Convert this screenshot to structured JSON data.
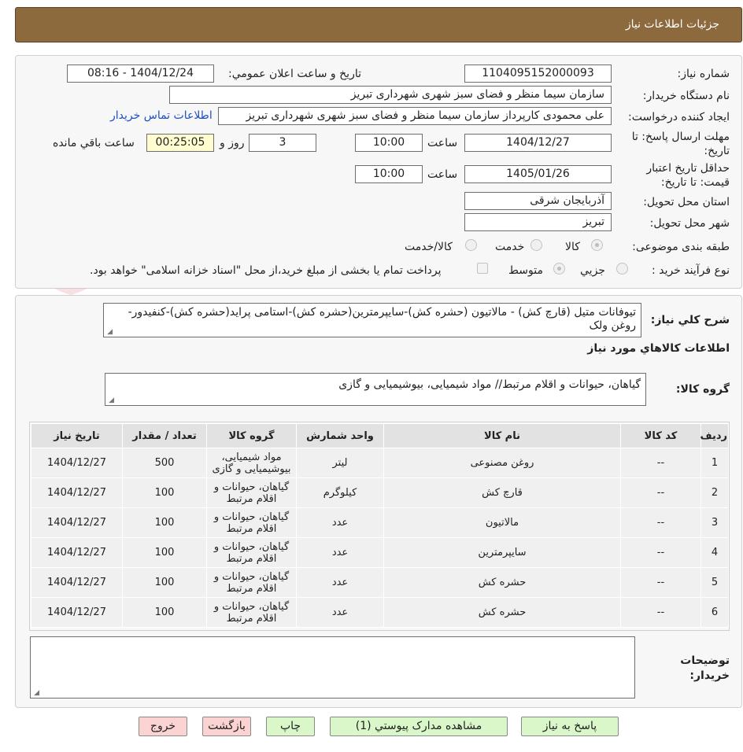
{
  "header": {
    "title": "جزئیات اطلاعات نیاز"
  },
  "form": {
    "need_number_label": "شماره نیاز:",
    "need_number": "1104095152000093",
    "announce_label": "تاریخ و ساعت اعلان عمومي:",
    "announce_value": "1404/12/24 - 08:16",
    "buyer_org_label": "نام دستگاه خریدار:",
    "buyer_org": "سازمان سیما منظر و فضای سبز شهری شهرداری تبریز",
    "requester_label": "ایجاد کننده درخواست:",
    "requester": "علی محمودی کارپرداز سازمان سیما منظر و فضای سبز شهری شهرداری تبریز",
    "buyer_contact_link": "اطلاعات تماس خریدار",
    "deadline_label": "مهلت ارسال پاسخ: تا تاریخ:",
    "deadline_date": "1404/12/27",
    "time_label": "ساعت",
    "deadline_time": "10:00",
    "days_value": "3",
    "days_label": "روز و",
    "remaining_time": "00:25:05",
    "remaining_label": "ساعت باقي مانده",
    "validity_label": "حداقل تاریخ اعتبار قیمت: تا تاریخ:",
    "validity_date": "1405/01/26",
    "validity_time": "10:00",
    "province_label": "استان محل تحویل:",
    "province": "آذربایجان شرقی",
    "city_label": "شهر محل تحویل:",
    "city": "تبریز",
    "category_label": "طبقه بندی موضوعی:",
    "category_options": [
      "کالا",
      "خدمت",
      "کالا/خدمت"
    ],
    "process_label": "نوع فرآیند خرید :",
    "process_options": [
      "جزیي",
      "متوسط"
    ],
    "payment_note": "پرداخت تمام یا بخشی از مبلغ خرید،از محل \"اسناد خزانه اسلامی\" خواهد بود."
  },
  "description": {
    "label": "شرح کلي نياز:",
    "text": "تیوفانات متیل (قارچ کش) - مالاتیون (حشره کش)-سایپرمترین(حشره کش)-استامی پراید(حشره کش)-کنفیدور- روغن ولک"
  },
  "goods": {
    "section_title": "اطلاعات کالاهاي مورد نياز",
    "group_label": "گروه کالا:",
    "group_value": "گیاهان، حیوانات و اقلام مرتبط// مواد شیمیایی، بیوشیمیایی و  گازی",
    "columns": [
      "ردیف",
      "کد کالا",
      "نام کالا",
      "واحد شمارش",
      "گروه کالا",
      "تعداد / مقدار",
      "تاریخ نیاز"
    ],
    "rows": [
      {
        "idx": "1",
        "code": "--",
        "name": "روغن مصنوعی",
        "unit": "لیتر",
        "group": "مواد شیمیایی، بیوشیمیایی و گازی",
        "qty": "500",
        "date": "1404/12/27"
      },
      {
        "idx": "2",
        "code": "--",
        "name": "قارچ کش",
        "unit": "کیلوگرم",
        "group": "گیاهان، حیوانات و اقلام مرتبط",
        "qty": "100",
        "date": "1404/12/27"
      },
      {
        "idx": "3",
        "code": "--",
        "name": "مالاتیون",
        "unit": "عدد",
        "group": "گیاهان، حیوانات و اقلام مرتبط",
        "qty": "100",
        "date": "1404/12/27"
      },
      {
        "idx": "4",
        "code": "--",
        "name": "سایپرمترین",
        "unit": "عدد",
        "group": "گیاهان، حیوانات و اقلام مرتبط",
        "qty": "100",
        "date": "1404/12/27"
      },
      {
        "idx": "5",
        "code": "--",
        "name": "حشره کش",
        "unit": "عدد",
        "group": "گیاهان، حیوانات و اقلام مرتبط",
        "qty": "100",
        "date": "1404/12/27"
      },
      {
        "idx": "6",
        "code": "--",
        "name": "حشره کش",
        "unit": "عدد",
        "group": "گیاهان، حیوانات و اقلام مرتبط",
        "qty": "100",
        "date": "1404/12/27"
      }
    ]
  },
  "buyer_notes": {
    "label": "توضیحات خریدار:",
    "text": ""
  },
  "buttons": {
    "reply": "پاسخ به نياز",
    "attachments": "مشاهده مدارک پیوستي (1)",
    "print": "چاپ",
    "back": "بازگشت",
    "exit": "خروج"
  },
  "watermark": {
    "text": "AriaTender.neT"
  }
}
